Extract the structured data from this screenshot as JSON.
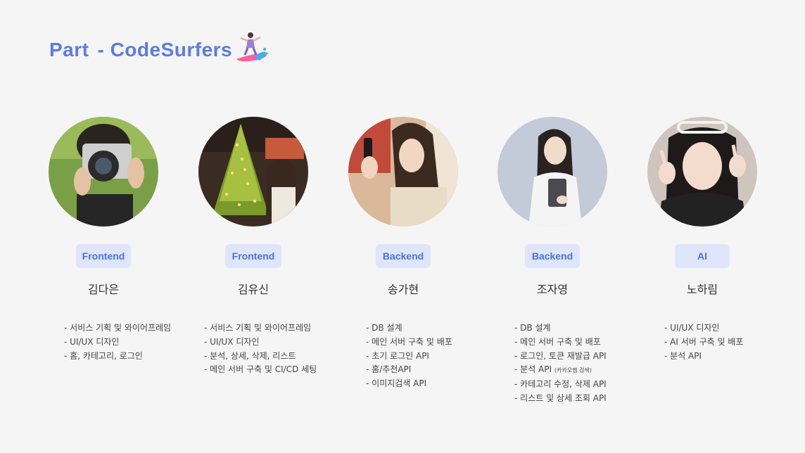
{
  "header": {
    "part_label": "Part",
    "team_name": "- CodeSurfers"
  },
  "members": [
    {
      "role": "Frontend",
      "name": "김다은",
      "duties": [
        "서비스 기획 및 와이어프레임",
        "UI/UX 디자인",
        "홈, 카테고리, 로그인"
      ]
    },
    {
      "role": "Frontend",
      "name": "김유신",
      "duties": [
        "서비스 기획 및 와이어프레임",
        "UI/UX 디자인",
        "분석, 상세, 삭제, 리스트",
        "메인 서버 구축 및 CI/CD 세팅"
      ]
    },
    {
      "role": "Backend",
      "name": "송가현",
      "duties": [
        "DB 설계",
        "메인 서버 구축 및 배포",
        "초기 로그인 API",
        "홈/추천API",
        "이미지검색 API"
      ]
    },
    {
      "role": "Backend",
      "name": "조자영",
      "duties": [
        "DB 설계",
        "메인 서버 구축 및 배포",
        "로그인, 토큰 재발급 API",
        "분석 API",
        "카테고리 수정, 삭제 API",
        "리스트 및 상세 조회 API"
      ],
      "duty_note": "(카카오맵 검색)"
    },
    {
      "role": "AI",
      "name": "노하림",
      "duties": [
        "UI/UX 디자인",
        "AI 서버 구축 및 배포",
        "분석 API"
      ]
    }
  ],
  "colors": {
    "accent": "#5b7be6",
    "badge_bg": "#dfe6fb",
    "badge_text": "#4a73e0",
    "background": "#f5f5f6"
  },
  "icons": {
    "title_emoji": "woman-surfing-icon"
  }
}
